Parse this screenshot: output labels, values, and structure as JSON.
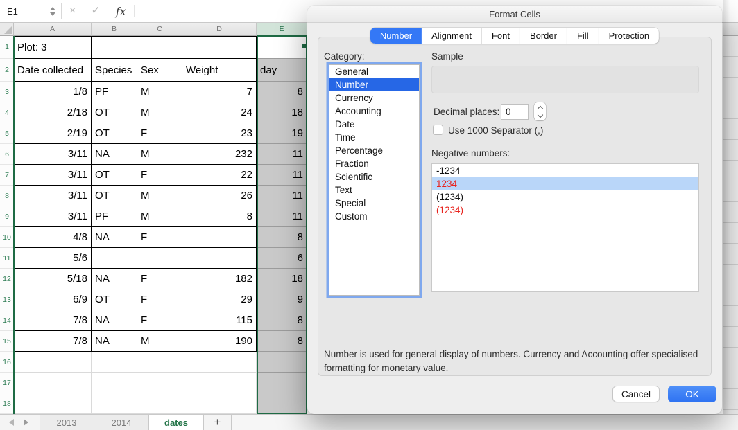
{
  "formula_bar": {
    "cell_reference": "E1",
    "cancel_glyph": "×",
    "enter_glyph": "✓",
    "fx_glyph": "fx"
  },
  "sheet": {
    "column_headers": [
      "A",
      "B",
      "C",
      "D",
      "E"
    ],
    "selected_column": "E",
    "partial_column_header": "D",
    "row_count": 18,
    "rows": [
      [
        "Plot: 3",
        "",
        "",
        "",
        ""
      ],
      [
        "Date collected",
        "Species",
        "Sex",
        "Weight",
        "day"
      ],
      [
        "1/8",
        "PF",
        "M",
        "7",
        "8"
      ],
      [
        "2/18",
        "OT",
        "M",
        "24",
        "18"
      ],
      [
        "2/19",
        "OT",
        "F",
        "23",
        "19"
      ],
      [
        "3/11",
        "NA",
        "M",
        "232",
        "11"
      ],
      [
        "3/11",
        "OT",
        "F",
        "22",
        "11"
      ],
      [
        "3/11",
        "OT",
        "M",
        "26",
        "11"
      ],
      [
        "3/11",
        "PF",
        "M",
        "8",
        "11"
      ],
      [
        "4/8",
        "NA",
        "F",
        "",
        "8"
      ],
      [
        "5/6",
        "",
        "",
        "",
        "6"
      ],
      [
        "5/18",
        "NA",
        "F",
        "182",
        "18"
      ],
      [
        "6/9",
        "OT",
        "F",
        "29",
        "9"
      ],
      [
        "7/8",
        "NA",
        "F",
        "115",
        "8"
      ],
      [
        "7/8",
        "NA",
        "M",
        "190",
        "8"
      ],
      [
        "",
        "",
        "",
        "",
        ""
      ],
      [
        "",
        "",
        "",
        "",
        ""
      ],
      [
        "",
        "",
        "",
        "",
        ""
      ]
    ]
  },
  "sheet_tabs": {
    "tabs": [
      "2013",
      "2014",
      "dates"
    ],
    "active": "dates",
    "add_label": "+"
  },
  "dialog": {
    "title": "Format Cells",
    "tabs": [
      "Number",
      "Alignment",
      "Font",
      "Border",
      "Fill",
      "Protection"
    ],
    "active_tab": "Number",
    "category_label": "Category:",
    "categories": [
      "General",
      "Number",
      "Currency",
      "Accounting",
      "Date",
      "Time",
      "Percentage",
      "Fraction",
      "Scientific",
      "Text",
      "Special",
      "Custom"
    ],
    "selected_category": "Number",
    "sample_label": "Sample",
    "sample_value": "",
    "decimal_places_label": "Decimal places:",
    "decimal_places_value": "0",
    "thousand_separator_label": "Use 1000 Separator (,)",
    "thousand_separator_checked": false,
    "negative_numbers_label": "Negative numbers:",
    "negative_options": [
      {
        "text": "-1234",
        "red": false,
        "selected": false
      },
      {
        "text": "1234",
        "red": true,
        "selected": true
      },
      {
        "text": "(1234)",
        "red": false,
        "selected": false
      },
      {
        "text": "(1234)",
        "red": true,
        "selected": false
      }
    ],
    "description": "Number is used for general display of numbers.  Currency and Accounting offer specialised formatting for monetary value.",
    "cancel_label": "Cancel",
    "ok_label": "OK"
  },
  "colors": {
    "excel_green": "#217346",
    "selection_border": "#1e6b44",
    "tab_active_blue": "#3478f6",
    "list_selection_blue": "#2667e6",
    "row_highlight_blue": "#b9d6f9",
    "negative_red": "#e8231d"
  }
}
